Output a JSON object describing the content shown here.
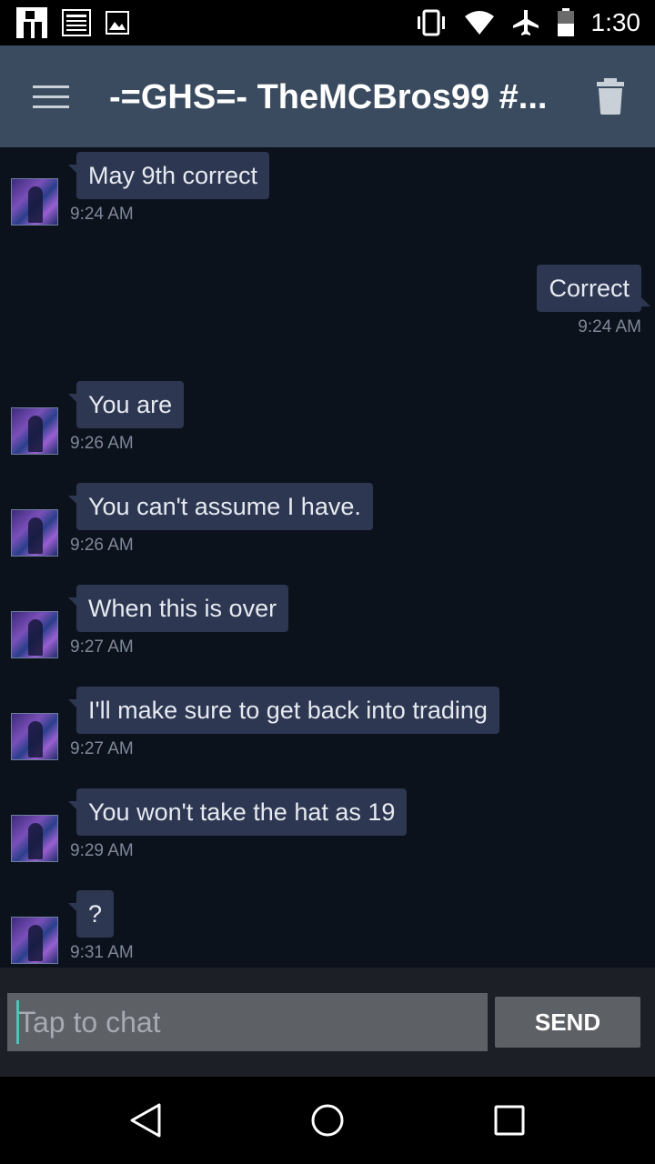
{
  "status_bar": {
    "time": "1:30",
    "left_icons": [
      "app-notification-icon",
      "news-notification-icon",
      "image-notification-icon"
    ],
    "right_icons": [
      "vibrate-icon",
      "wifi-icon",
      "airplane-mode-icon",
      "battery-icon"
    ]
  },
  "app_bar": {
    "title": "-=GHS=- TheMCBros99 #..."
  },
  "messages": [
    {
      "text": "May 9th correct",
      "time": "9:24 AM",
      "direction": "in"
    },
    {
      "text": "Correct",
      "time": "9:24 AM",
      "direction": "out"
    },
    {
      "text": "You are",
      "time": "9:26 AM",
      "direction": "in"
    },
    {
      "text": "You can't assume I have.",
      "time": "9:26 AM",
      "direction": "in"
    },
    {
      "text": "When this is over",
      "time": "9:27 AM",
      "direction": "in"
    },
    {
      "text": "I'll make sure to get back into trading",
      "time": "9:27 AM",
      "direction": "in"
    },
    {
      "text": "You won't take the hat as 19",
      "time": "9:29 AM",
      "direction": "in"
    },
    {
      "text": "?",
      "time": "9:31 AM",
      "direction": "in"
    }
  ],
  "composer": {
    "placeholder": "Tap to chat",
    "send_label": "SEND"
  },
  "colors": {
    "app_bar": "#3a4b60",
    "chat_background": "#0c121c",
    "bubble": "#2d3752",
    "input_bar": "#1c2026"
  }
}
